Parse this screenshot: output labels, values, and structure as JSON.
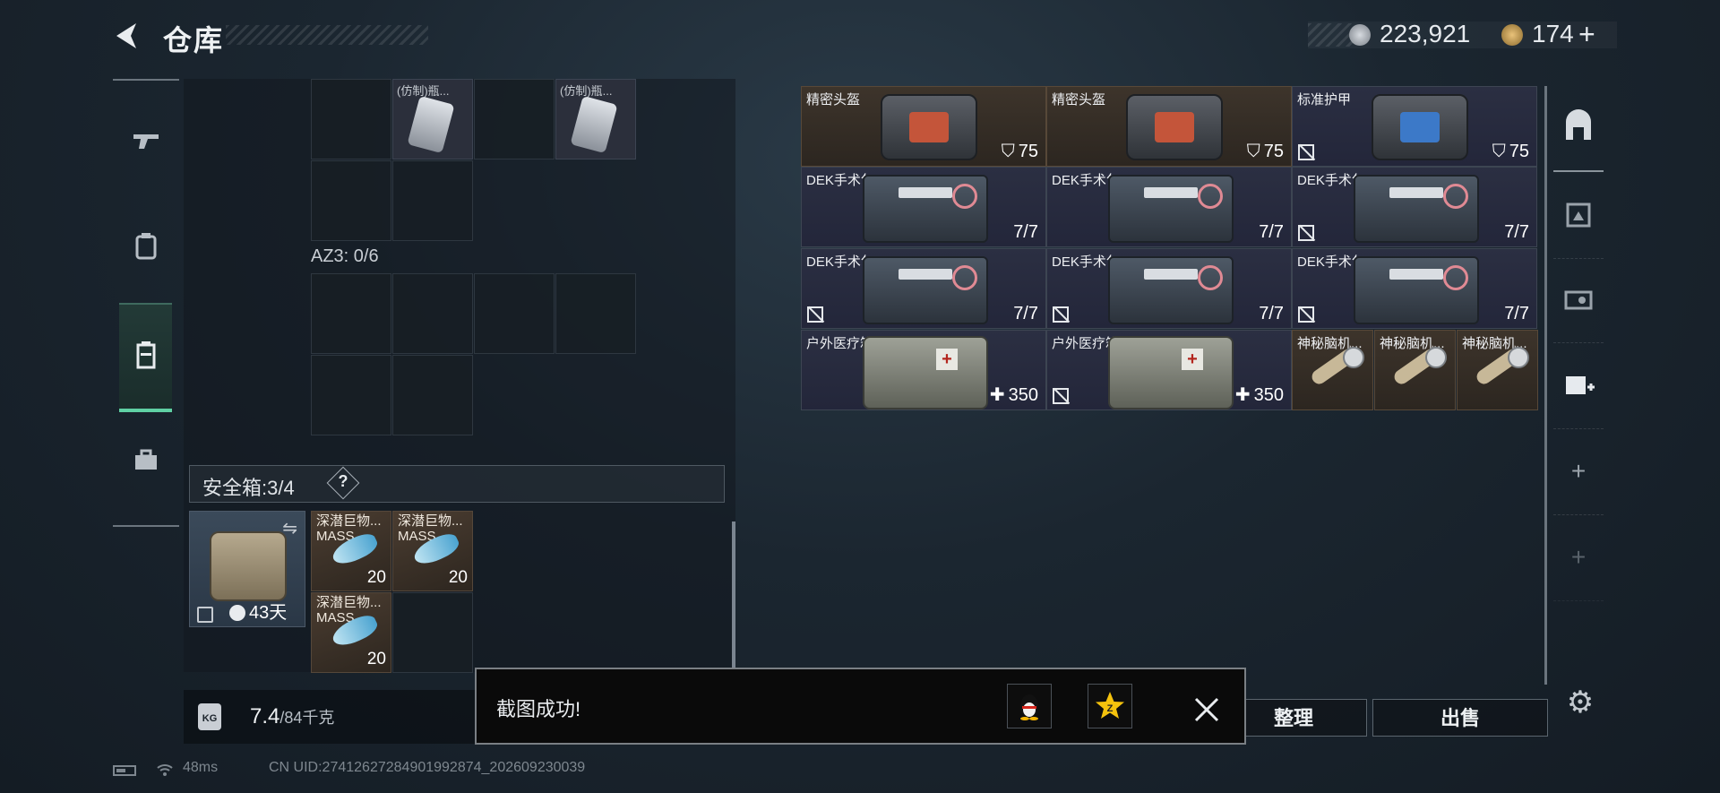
{
  "header": {
    "title": "仓库",
    "currency_silver": "223,921",
    "currency_gold": "174",
    "gold_plus": "+"
  },
  "left_panel": {
    "top_item_labels": [
      "(仿制)瓶...",
      "(仿制)瓶..."
    ],
    "az3_label": "AZ3: 0/6",
    "safe_box_label": "安全箱:3/4",
    "safe_box_help": "?",
    "safe_box_days": "43天",
    "fish_items": [
      {
        "name": "深潜巨物...",
        "sub": "MASS",
        "count": "20"
      },
      {
        "name": "深潜巨物...",
        "sub": "MASS",
        "count": "20"
      },
      {
        "name": "深潜巨物...",
        "sub": "MASS",
        "count": "20"
      }
    ],
    "weight_current": "7.4",
    "weight_max": "/84千克",
    "kg_icon_label": "KG"
  },
  "right_grid": {
    "rows": [
      [
        {
          "name": "精密头盔",
          "value": "75",
          "kind": "helmet",
          "no_trade": false
        },
        {
          "name": "精密头盔",
          "value": "75",
          "kind": "helmet",
          "no_trade": false
        },
        {
          "name": "标准护甲",
          "value": "75",
          "kind": "armor",
          "no_trade": true
        }
      ],
      [
        {
          "name": "DEK手术包",
          "value": "7/7",
          "kind": "kit",
          "no_trade": false
        },
        {
          "name": "DEK手术包",
          "value": "7/7",
          "kind": "kit",
          "no_trade": false
        },
        {
          "name": "DEK手术包",
          "value": "7/7",
          "kind": "kit",
          "no_trade": true
        }
      ],
      [
        {
          "name": "DEK手术包",
          "value": "7/7",
          "kind": "kit",
          "no_trade": true
        },
        {
          "name": "DEK手术包",
          "value": "7/7",
          "kind": "kit",
          "no_trade": true
        },
        {
          "name": "DEK手术包",
          "value": "7/7",
          "kind": "kit",
          "no_trade": true
        }
      ],
      [
        {
          "name": "户外医疗箱",
          "value": "350",
          "kind": "medbox",
          "no_trade": false
        },
        {
          "name": "户外医疗箱",
          "value": "350",
          "kind": "medbox",
          "no_trade": true
        }
      ]
    ],
    "small_items": [
      "神秘脑机...",
      "神秘脑机...",
      "神秘脑机..."
    ]
  },
  "buttons": {
    "sort": "整理",
    "sell": "出售"
  },
  "toast": {
    "message": "截图成功!"
  },
  "status": {
    "ping": "48ms",
    "uid": "CN UID:27412627284901992874_202609230039"
  },
  "colors": {
    "accent_green": "#5fd0a4",
    "brown_cell": "#3d342b",
    "blue_cell": "#2b2f42"
  },
  "icons": {
    "back": "chevron-left-icon",
    "silver_coin": "silver-coin-icon",
    "gold_coin": "gold-coin-icon",
    "shield": "shield-icon",
    "plus": "plus-icon",
    "settings": "gear-icon",
    "close": "close-icon"
  }
}
